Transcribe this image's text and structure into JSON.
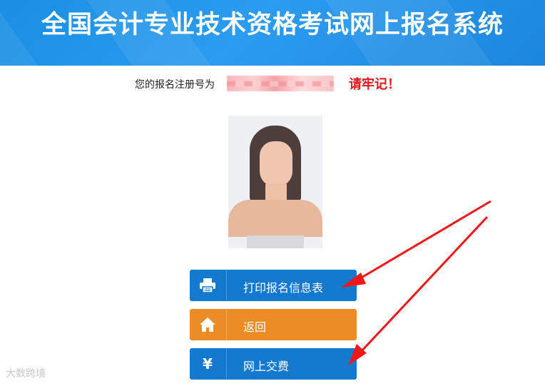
{
  "header": {
    "title": "全国会计专业技术资格考试网上报名系统"
  },
  "registration": {
    "label": "您的报名注册号为",
    "reminder": "请牢记！"
  },
  "buttons": [
    {
      "label": "打印报名信息表",
      "icon": "printer-icon",
      "color": "#1279cf"
    },
    {
      "label": "返回",
      "icon": "home-icon",
      "color": "#eb8c27"
    },
    {
      "label": "网上交费",
      "icon": "yen-icon",
      "icon_text": "¥",
      "color": "#1279cf"
    }
  ],
  "watermark": "大数跨境",
  "colors": {
    "header": "#1a8fe3",
    "accent_red": "#e8141c",
    "annotation_arrow": "#f01818"
  }
}
